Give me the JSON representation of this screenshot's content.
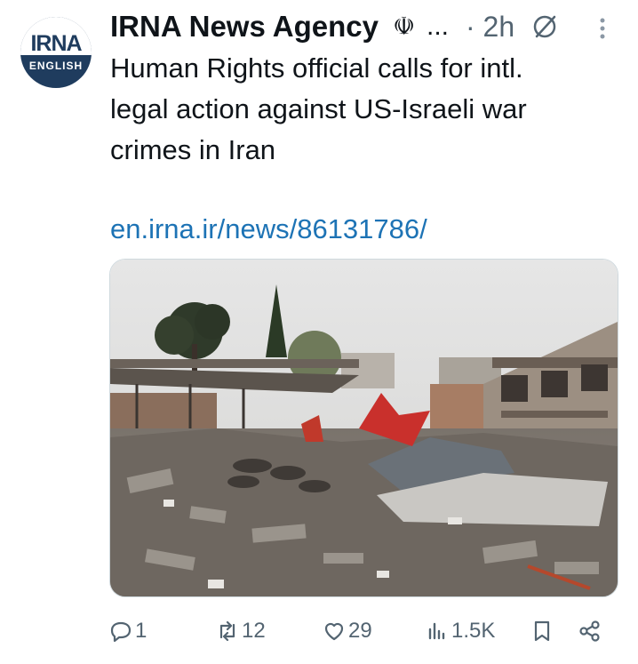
{
  "account": {
    "name": "IRNA News Agency",
    "emblem_icon": "iran-emblem-icon",
    "truncation": "...",
    "separator_time": "· 2h",
    "avatar": {
      "line1": "IRNA",
      "line2": "ENGLISH"
    }
  },
  "tweet": {
    "text": "Human Rights official calls for intl.\nlegal action against US-Israeli war\ncrimes in Iran",
    "link": "en.irna.ir/news/86131786/"
  },
  "actions": {
    "replies": "1",
    "reposts": "12",
    "likes": "29",
    "views": "1.5K"
  },
  "colors": {
    "text": "#0f1419",
    "secondary": "#536471",
    "link": "#1d73b5",
    "avatar_bg": "#1f3c5e"
  }
}
